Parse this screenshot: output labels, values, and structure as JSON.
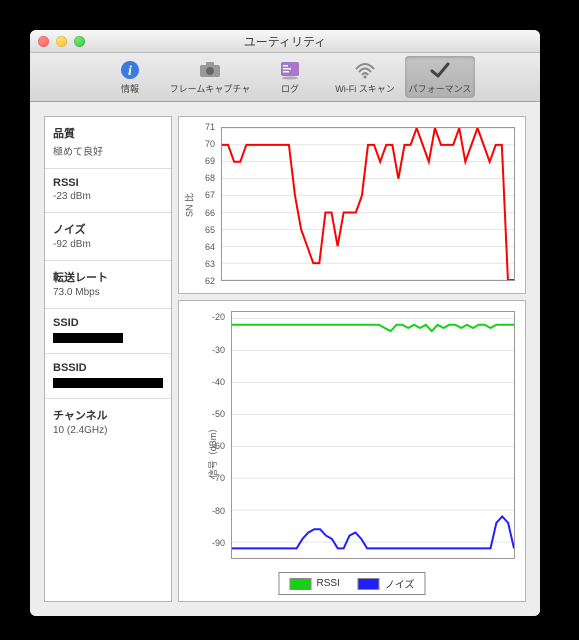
{
  "window": {
    "title": "ユーティリティ"
  },
  "toolbar": {
    "items": [
      {
        "label": "情報"
      },
      {
        "label": "フレームキャプチャ"
      },
      {
        "label": "ログ"
      },
      {
        "label": "Wi-Fi スキャン"
      },
      {
        "label": "パフォーマンス"
      }
    ]
  },
  "sidebar": {
    "quality": {
      "label": "品質",
      "value": "極めて良好"
    },
    "rssi": {
      "label": "RSSI",
      "value": "-23 dBm"
    },
    "noise": {
      "label": "ノイズ",
      "value": "-92 dBm"
    },
    "rate": {
      "label": "転送レート",
      "value": "73.0 Mbps"
    },
    "ssid": {
      "label": "SSID"
    },
    "bssid": {
      "label": "BSSID"
    },
    "channel": {
      "label": "チャンネル",
      "value": "10 (2.4GHz)"
    }
  },
  "legend": {
    "rssi": "RSSI",
    "noise": "ノイズ"
  },
  "axis": {
    "sn": "SN 比",
    "signal": "信号（dBm）"
  },
  "colors": {
    "red": "#ff0000",
    "green": "#18d018",
    "blue": "#2020ff"
  },
  "chart_data": [
    {
      "type": "line",
      "title": "",
      "ylabel": "SN 比",
      "ylim": [
        62,
        71
      ],
      "yticks": [
        62,
        63,
        64,
        65,
        66,
        67,
        68,
        69,
        70,
        71
      ],
      "series": [
        {
          "name": "SN",
          "color": "#ff0000",
          "values": [
            70,
            70,
            69,
            69,
            70,
            70,
            70,
            70,
            70,
            70,
            70,
            70,
            67,
            65,
            64,
            63,
            63,
            66,
            66,
            64,
            66,
            66,
            66,
            67,
            70,
            70,
            69,
            70,
            70,
            68,
            70,
            70,
            71,
            70,
            69,
            71,
            70,
            70,
            70,
            71,
            69,
            70,
            71,
            70,
            69,
            70,
            70,
            62,
            62
          ]
        }
      ]
    },
    {
      "type": "line",
      "title": "",
      "ylabel": "信号（dBm）",
      "ylim": [
        -95,
        -18
      ],
      "yticks": [
        -90,
        -80,
        -70,
        -60,
        -50,
        -40,
        -30,
        -20
      ],
      "series": [
        {
          "name": "RSSI",
          "color": "#18d018",
          "values": [
            -22,
            -22,
            -22,
            -22,
            -22,
            -22,
            -22,
            -22,
            -22,
            -22,
            -22,
            -22,
            -22,
            -22,
            -22,
            -22,
            -22,
            -22,
            -22,
            -22,
            -22,
            -22,
            -22,
            -22,
            -22,
            -22,
            -23,
            -24,
            -22,
            -22,
            -23,
            -22,
            -23,
            -22,
            -24,
            -22,
            -23,
            -22,
            -22,
            -23,
            -22,
            -23,
            -22,
            -22,
            -23,
            -22,
            -22,
            -22,
            -22
          ]
        },
        {
          "name": "ノイズ",
          "color": "#2020ff",
          "values": [
            -92,
            -92,
            -92,
            -92,
            -92,
            -92,
            -92,
            -92,
            -92,
            -92,
            -92,
            -92,
            -89,
            -87,
            -86,
            -86,
            -88,
            -89,
            -92,
            -92,
            -88,
            -87,
            -89,
            -92,
            -92,
            -92,
            -92,
            -92,
            -92,
            -92,
            -92,
            -92,
            -92,
            -92,
            -92,
            -92,
            -92,
            -92,
            -92,
            -92,
            -92,
            -92,
            -92,
            -92,
            -92,
            -84,
            -82,
            -84,
            -92
          ]
        }
      ]
    }
  ]
}
